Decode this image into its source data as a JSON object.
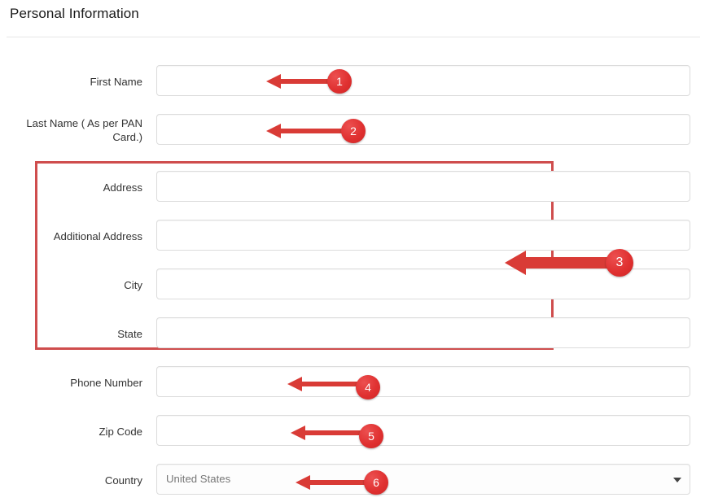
{
  "header": {
    "title": "Personal Information"
  },
  "form": {
    "fields": [
      {
        "label": "First Name",
        "value": "",
        "type": "text",
        "lines": 1
      },
      {
        "label": "Last Name ( As per PAN Card.)",
        "value": "",
        "type": "text",
        "lines": 2
      },
      {
        "label": "Address",
        "value": "",
        "type": "text",
        "lines": 1
      },
      {
        "label": "Additional Address",
        "value": "",
        "type": "text",
        "lines": 1
      },
      {
        "label": "City",
        "value": "",
        "type": "text",
        "lines": 1
      },
      {
        "label": "State",
        "value": "",
        "type": "text",
        "lines": 1
      },
      {
        "label": "Phone Number",
        "value": "",
        "type": "text",
        "lines": 1
      },
      {
        "label": "Zip Code",
        "value": "",
        "type": "text",
        "lines": 1
      },
      {
        "label": "Country",
        "value": "United States",
        "type": "select",
        "lines": 1
      }
    ]
  },
  "annotations": {
    "steps": [
      {
        "number": "1",
        "target": "First Name"
      },
      {
        "number": "2",
        "target": "Last Name ( As per PAN Card.)"
      },
      {
        "number": "3",
        "target": "Address block"
      },
      {
        "number": "4",
        "target": "Phone Number"
      },
      {
        "number": "5",
        "target": "Zip Code"
      },
      {
        "number": "6",
        "target": "Country"
      }
    ],
    "highlight_label": "Address group highlight"
  },
  "colors": {
    "arrow_red": "#d93b36",
    "badge_red": "#e03131",
    "highlight_border": "#cf4d4d",
    "input_border": "#dcdcdc",
    "text": "#333333"
  }
}
